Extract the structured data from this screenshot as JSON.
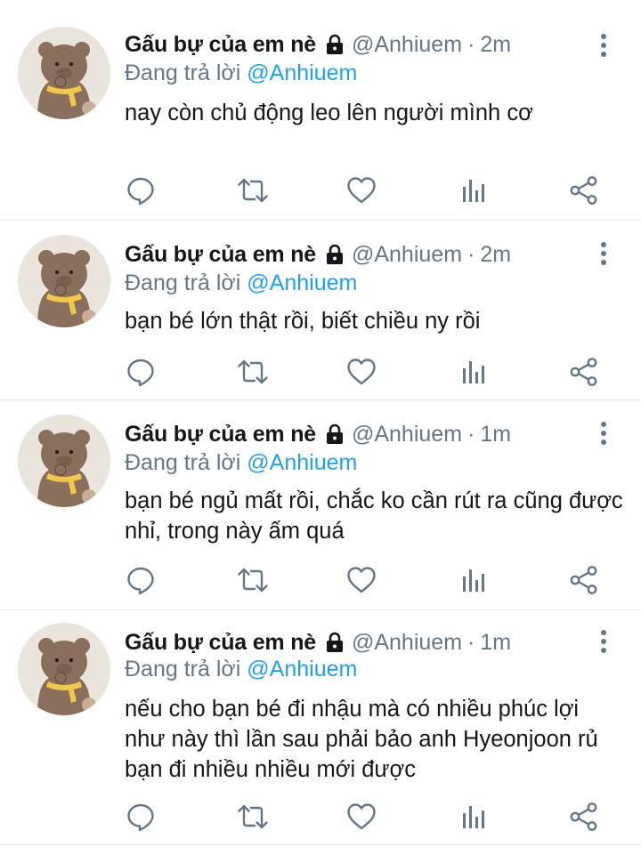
{
  "tweets": [
    {
      "name": "Gấu bự của em nè",
      "handle": "@Anhiuem",
      "separator": "·",
      "time": "2m",
      "reply_prefix": "Đang trả lời",
      "reply_to": "@Anhiuem",
      "text": "nay còn chủ động leo lên người mình cơ"
    },
    {
      "name": "Gấu bự của em nè",
      "handle": "@Anhiuem",
      "separator": "·",
      "time": "2m",
      "reply_prefix": "Đang trả lời",
      "reply_to": "@Anhiuem",
      "text": "bạn bé lớn thật rồi, biết chiều ny rồi"
    },
    {
      "name": "Gấu bự của em nè",
      "handle": "@Anhiuem",
      "separator": "·",
      "time": "1m",
      "reply_prefix": "Đang trả lời",
      "reply_to": "@Anhiuem",
      "text": "bạn bé ngủ mất rồi, chắc ko cần rút ra cũng được nhỉ, trong này ấm quá"
    },
    {
      "name": "Gấu bự của em nè",
      "handle": "@Anhiuem",
      "separator": "·",
      "time": "1m",
      "reply_prefix": "Đang trả lời",
      "reply_to": "@Anhiuem",
      "text": "nếu cho bạn bé đi nhậu mà có nhiều phúc lợi như này thì lần sau phải bảo anh Hyeonjoon rủ bạn đi nhiều nhiều mới được"
    }
  ],
  "icons": {
    "avatar": "bear-avatar",
    "lock": "lock-icon",
    "more": "more-vertical-icon",
    "reply": "reply-icon",
    "retweet": "retweet-icon",
    "like": "heart-icon",
    "analytics": "analytics-icon",
    "share": "share-icon"
  },
  "colors": {
    "text": "#14171a",
    "secondary": "#657786",
    "link": "#1da1f2",
    "divider": "#e1e8ed"
  }
}
